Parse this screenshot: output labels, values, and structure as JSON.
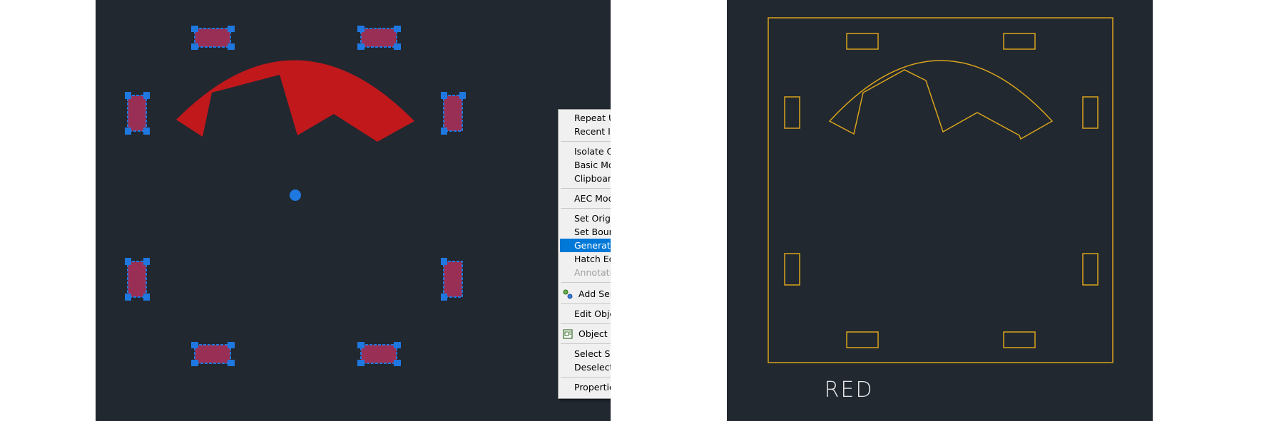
{
  "left_viewport": {
    "selected_objects": 8
  },
  "context_menu": {
    "items": [
      {
        "label": "Repeat U",
        "submenu": false
      },
      {
        "label": "Recent Input",
        "submenu": true
      },
      {
        "label": "Isolate Objects",
        "submenu": true
      },
      {
        "label": "Basic Modify Tools",
        "submenu": true
      },
      {
        "label": "Clipboard",
        "submenu": true
      },
      {
        "label": "AEC Modify Tools",
        "submenu": true
      },
      {
        "label": "Set Origin",
        "submenu": false
      },
      {
        "label": "Set Boundary",
        "submenu": false
      },
      {
        "label": "Generate Boundary",
        "submenu": false,
        "highlighted": true
      },
      {
        "label": "Hatch Edit...",
        "submenu": false
      },
      {
        "label": "Annotative Object Scale",
        "submenu": true,
        "disabled": true
      },
      {
        "label": "Add Selected",
        "icon": "add-selected-icon"
      },
      {
        "label": "Edit Object Display..."
      },
      {
        "label": "Object Viewer...",
        "icon": "object-viewer-icon"
      },
      {
        "label": "Select Similar"
      },
      {
        "label": "Deselect All"
      },
      {
        "label": "Properties"
      }
    ],
    "submenu_arrow": "▸"
  },
  "right_viewport": {
    "caption": "RED"
  },
  "colors": {
    "canvas": "#212830",
    "hatch_red": "#c0181b",
    "grip_blue": "#1e78e0",
    "selected_fill": "#9a2f55",
    "outline_yellow": "#d9a31c",
    "menu_highlight": "#0078d7"
  }
}
